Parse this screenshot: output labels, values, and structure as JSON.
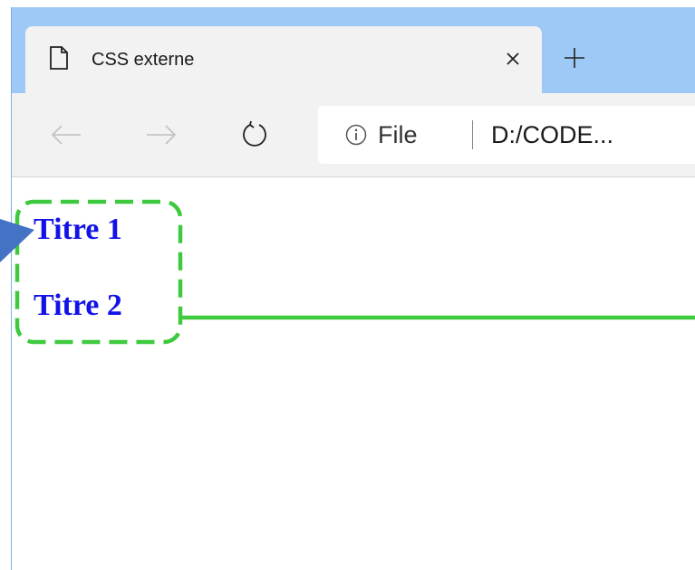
{
  "browser": {
    "tab": {
      "title": "CSS externe",
      "close_icon": "close-icon",
      "page_icon": "page-icon"
    },
    "new_tab_icon": "plus-icon",
    "toolbar": {
      "back_icon": "back-arrow-icon",
      "forward_icon": "forward-arrow-icon",
      "reload_icon": "reload-icon"
    },
    "address": {
      "info_icon": "info-icon",
      "scheme": "File",
      "url": "D:/CODE..."
    }
  },
  "page": {
    "headings": [
      "Titre 1",
      "Titre 2"
    ]
  },
  "colors": {
    "tabstrip": "#9ec9f6",
    "heading": "#1212e6",
    "annotation_green": "#3ec93e",
    "annotation_arrow": "#4472c4"
  }
}
